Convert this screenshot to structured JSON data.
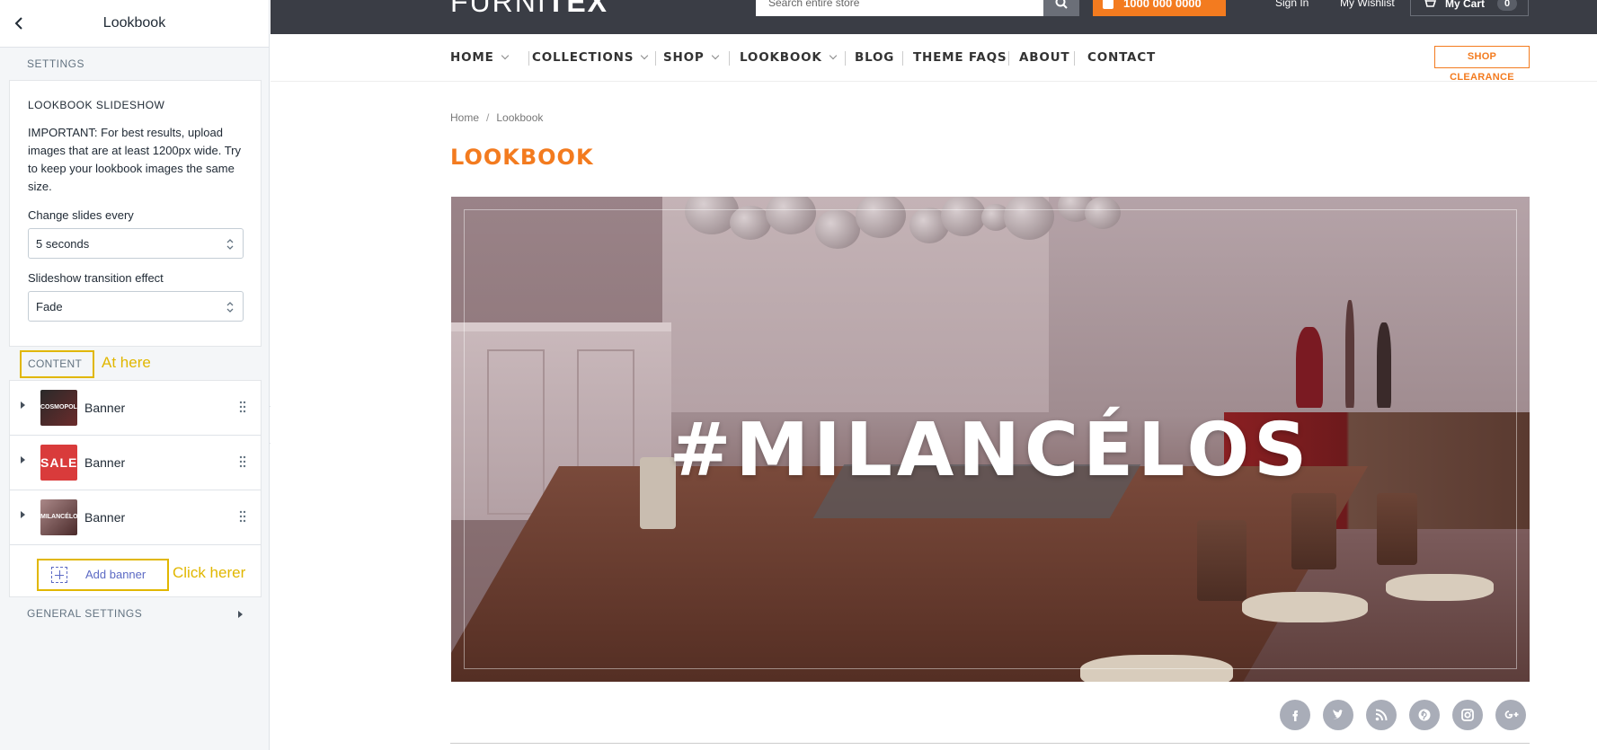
{
  "sidebar": {
    "title": "Lookbook",
    "settings_label": "SETTINGS",
    "slideshow_card": {
      "title": "LOOKBOOK SLIDESHOW",
      "info": "IMPORTANT: For best results, upload images that are at least 1200px wide. Try to keep your lookbook images the same size.",
      "change_slides_label": "Change slides every",
      "change_slides_value": "5 seconds",
      "transition_label": "Slideshow transition effect",
      "transition_value": "Fade"
    },
    "content_label": "CONTENT",
    "annotation_here": "At here",
    "banners": [
      {
        "label": "Banner",
        "thumb_text": "COSMOPOLI"
      },
      {
        "label": "Banner",
        "thumb_text": "SALE"
      },
      {
        "label": "Banner",
        "thumb_text": "MILANCÉLO"
      }
    ],
    "add_banner_label": "Add banner",
    "annotation_click": "Click herer",
    "general_settings_label": "GENERAL SETTINGS"
  },
  "store": {
    "logo_light": "FURNI",
    "logo_bold": "TEX",
    "search_placeholder": "Search entire store",
    "phone": "1000 000 0000",
    "sign_in": "Sign In",
    "wishlist": "My Wishlist",
    "cart_label": "My Cart",
    "cart_count": "0",
    "nav": [
      {
        "label": "HOME",
        "dropdown": true
      },
      {
        "label": "COLLECTIONS",
        "dropdown": true
      },
      {
        "label": "SHOP",
        "dropdown": true
      },
      {
        "label": "LOOKBOOK",
        "dropdown": true
      },
      {
        "label": "BLOG",
        "dropdown": false
      },
      {
        "label": "THEME FAQS",
        "dropdown": false
      },
      {
        "label": "ABOUT",
        "dropdown": false
      },
      {
        "label": "CONTACT",
        "dropdown": false
      }
    ],
    "clearance_label": "SHOP CLEARANCE",
    "breadcrumb_home": "Home",
    "breadcrumb_sep": "/",
    "breadcrumb_current": "Lookbook",
    "page_title": "LOOKBOOK",
    "hero_text": "#MILANCÉLOS",
    "social_icons": [
      "facebook-icon",
      "twitter-icon",
      "rss-icon",
      "pinterest-icon",
      "instagram-icon",
      "google-plus-icon"
    ]
  },
  "colors": {
    "accent_orange": "#f37b1f",
    "annotation_yellow": "#e1b700",
    "topbar": "#3a3d45",
    "link_blue": "#5c6ac4"
  }
}
